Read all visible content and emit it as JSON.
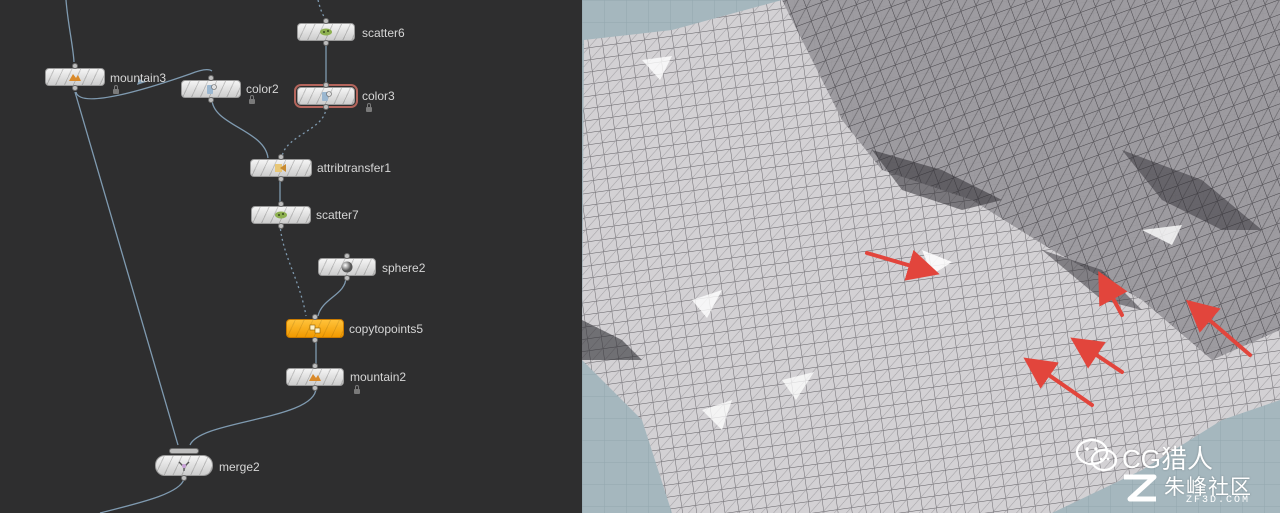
{
  "network_editor": {
    "nodes": [
      {
        "id": "scatter6",
        "label": "scatter6",
        "icon": "scatter-icon"
      },
      {
        "id": "mountain3",
        "label": "mountain3",
        "icon": "mountain-icon"
      },
      {
        "id": "color2",
        "label": "color2",
        "icon": "color-icon"
      },
      {
        "id": "color3",
        "label": "color3",
        "icon": "color-icon"
      },
      {
        "id": "attribtransfer1",
        "label": "attribtransfer1",
        "icon": "attribtransfer-icon"
      },
      {
        "id": "scatter7",
        "label": "scatter7",
        "icon": "scatter-icon"
      },
      {
        "id": "sphere2",
        "label": "sphere2",
        "icon": "sphere-icon"
      },
      {
        "id": "copytopoints5",
        "label": "copytopoints5",
        "icon": "copytopoints-icon"
      },
      {
        "id": "mountain2",
        "label": "mountain2",
        "icon": "mountain-icon"
      },
      {
        "id": "merge2",
        "label": "merge2",
        "icon": "merge-icon"
      }
    ],
    "selected_node": "copytopoints5",
    "colors": {
      "background": "#2e2e2f",
      "wire": "#7f9ab0",
      "selected": "#f4a21a",
      "current_outline": "#b4655c"
    }
  },
  "viewport": {
    "colors": {
      "background": "#9fb3bb",
      "mesh": "#d6d4d6",
      "arrow": "#e2453c"
    }
  },
  "watermark": {
    "title": "CG猎人",
    "subtitle": "朱峰社区",
    "url": "ZF3D.COM",
    "icon": "wechat-icon",
    "logo": "zf-logo-icon"
  }
}
